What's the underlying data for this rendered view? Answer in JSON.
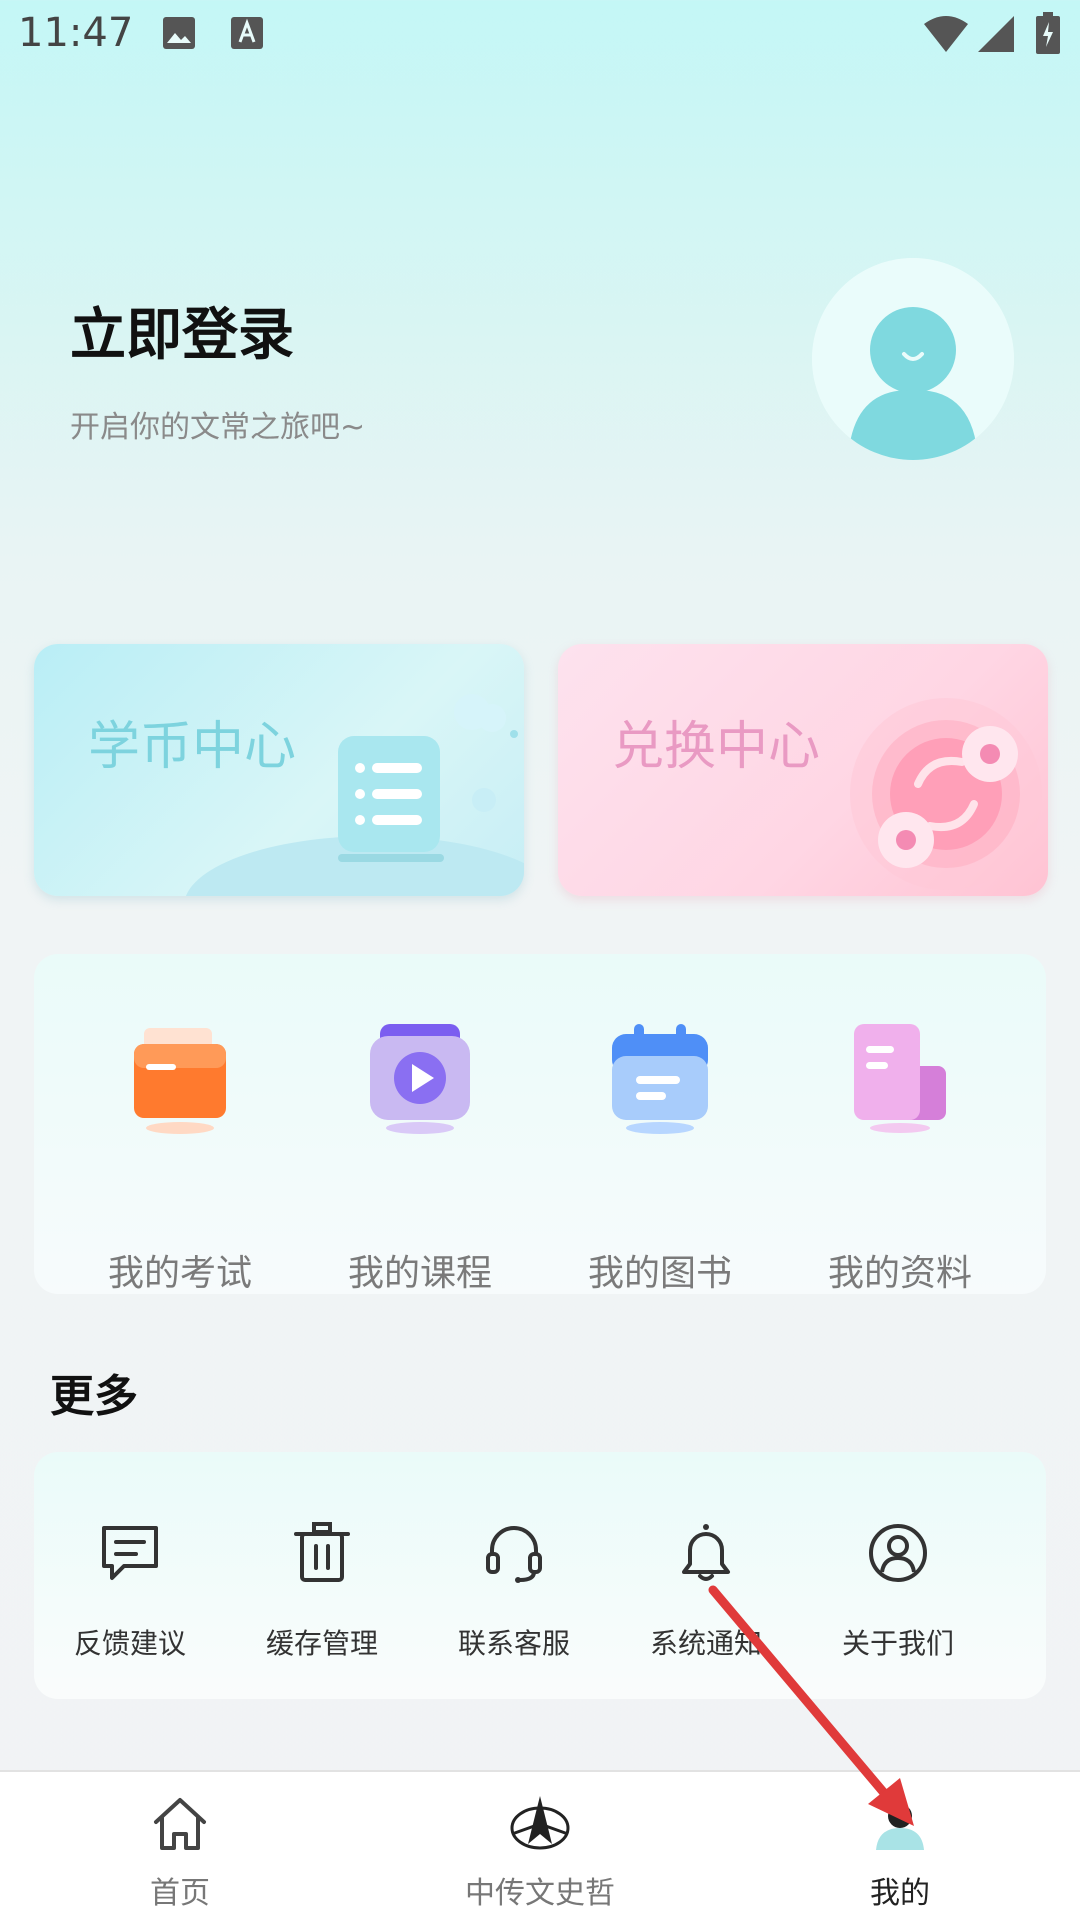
{
  "status_bar": {
    "time": "11:47"
  },
  "header": {
    "title": "立即登录",
    "subtitle": "开启你的文常之旅吧~"
  },
  "cards": {
    "coin_center": "学币中心",
    "exchange_center": "兑换中心"
  },
  "quick_menu": [
    {
      "label": "我的考试",
      "icon": "folder-icon"
    },
    {
      "label": "我的课程",
      "icon": "play-video-icon"
    },
    {
      "label": "我的图书",
      "icon": "calendar-book-icon"
    },
    {
      "label": "我的资料",
      "icon": "document-icon"
    }
  ],
  "more": {
    "title": "更多",
    "items": [
      {
        "label": "反馈建议",
        "icon": "feedback-icon"
      },
      {
        "label": "缓存管理",
        "icon": "trash-icon"
      },
      {
        "label": "联系客服",
        "icon": "headset-icon"
      },
      {
        "label": "系统通知",
        "icon": "bell-icon"
      },
      {
        "label": "关于我们",
        "icon": "user-circle-icon"
      }
    ]
  },
  "bottom_nav": [
    {
      "label": "首页",
      "icon": "home-icon"
    },
    {
      "label": "中传文史哲",
      "icon": "compass-logo-icon"
    },
    {
      "label": "我的",
      "icon": "profile-icon",
      "active": true
    }
  ],
  "colors": {
    "accent_teal": "#7dd3de",
    "accent_pink": "#e99ac3",
    "annotation_red": "#e03a3a"
  }
}
